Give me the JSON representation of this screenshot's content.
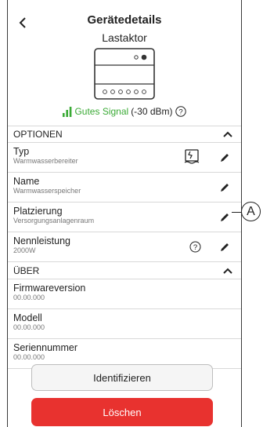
{
  "header": {
    "title": "Gerätedetails",
    "subtitle": "Lastaktor",
    "signal_label": "Gutes Signal",
    "signal_strength": "(-30 dBm)"
  },
  "options": {
    "section_label": "OPTIONEN",
    "rows": [
      {
        "label": "Typ",
        "value": "Warmwasserbereiter"
      },
      {
        "label": "Name",
        "value": "Warmwasserspeicher"
      },
      {
        "label": "Platzierung",
        "value": "Versorgungsanlagenraum"
      },
      {
        "label": "Nennleistung",
        "value": "2000W"
      }
    ]
  },
  "about": {
    "section_label": "ÜBER",
    "rows": [
      {
        "label": "Firmwareversion",
        "value": "00.00.000"
      },
      {
        "label": "Modell",
        "value": "00.00.000"
      },
      {
        "label": "Seriennummer",
        "value": "00.00.000"
      }
    ]
  },
  "buttons": {
    "identify": "Identifizieren",
    "delete": "Löschen"
  },
  "callout": {
    "letter": "A"
  },
  "colors": {
    "signal_green": "#3aaa35",
    "delete_red": "#e8322f"
  }
}
